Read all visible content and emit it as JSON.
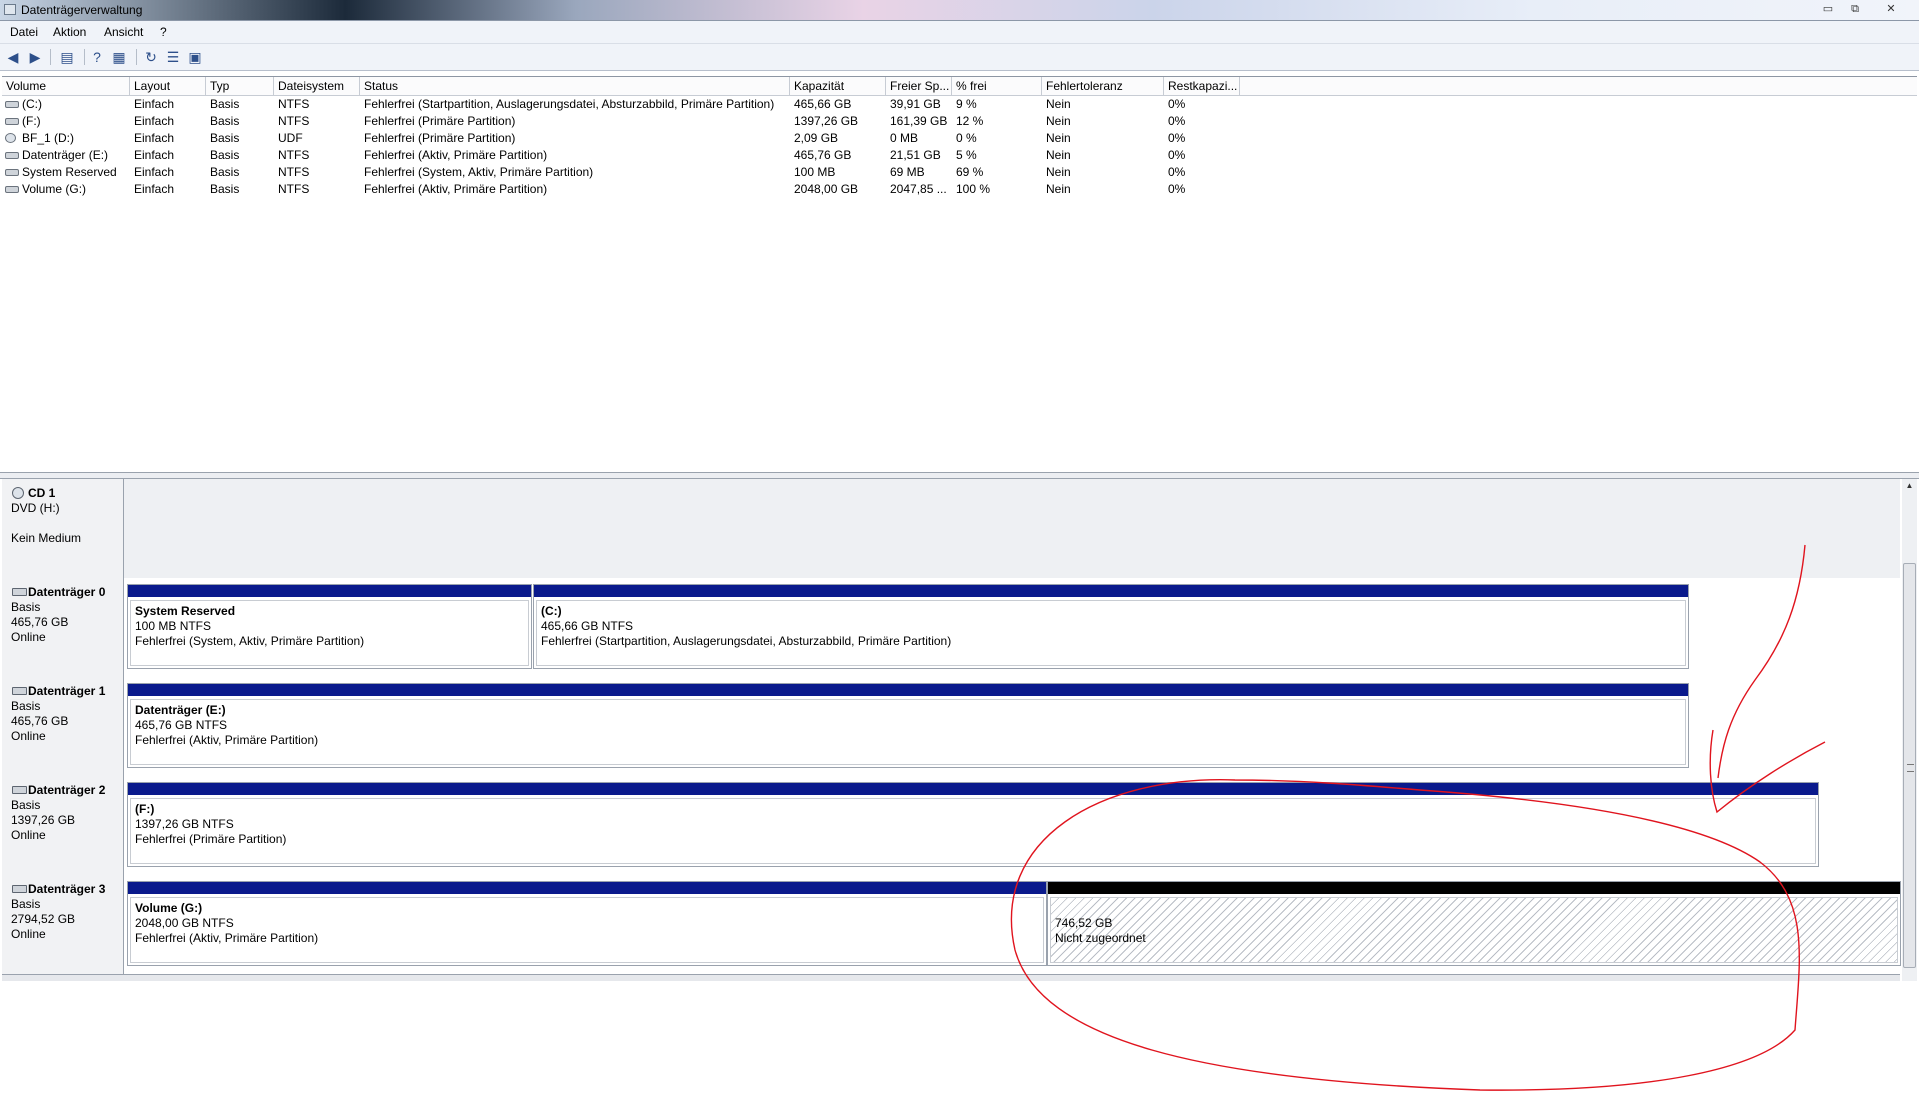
{
  "window": {
    "title": "Datenträgerverwaltung",
    "controls": {
      "minimize": "▭",
      "maximize": "⧉",
      "close": "✕"
    }
  },
  "menu": [
    "Datei",
    "Aktion",
    "Ansicht",
    "?"
  ],
  "toolbar": {
    "buttons": [
      "back-arrow-icon",
      "forward-arrow-icon",
      "console-tree-icon",
      "help-icon",
      "properties-icon",
      "refresh-icon",
      "settings-icon",
      "disk-icon"
    ]
  },
  "volumes": {
    "columns": [
      "Volume",
      "Layout",
      "Typ",
      "Dateisystem",
      "Status",
      "Kapazität",
      "Freier Sp...",
      "% frei",
      "Fehlertoleranz",
      "Restkapazi..."
    ],
    "rows": [
      [
        "(C:)",
        "Einfach",
        "Basis",
        "NTFS",
        "Fehlerfrei (Startpartition, Auslagerungsdatei, Absturzabbild, Primäre Partition)",
        "465,66 GB",
        "39,91 GB",
        "9 %",
        "Nein",
        "0%"
      ],
      [
        "(F:)",
        "Einfach",
        "Basis",
        "NTFS",
        "Fehlerfrei (Primäre Partition)",
        "1397,26 GB",
        "161,39 GB",
        "12 %",
        "Nein",
        "0%"
      ],
      [
        "BF_1 (D:)",
        "Einfach",
        "Basis",
        "UDF",
        "Fehlerfrei (Primäre Partition)",
        "2,09 GB",
        "0 MB",
        "0 %",
        "Nein",
        "0%"
      ],
      [
        "Datenträger (E:)",
        "Einfach",
        "Basis",
        "NTFS",
        "Fehlerfrei (Aktiv, Primäre Partition)",
        "465,76 GB",
        "21,51 GB",
        "5 %",
        "Nein",
        "0%"
      ],
      [
        "System Reserved",
        "Einfach",
        "Basis",
        "NTFS",
        "Fehlerfrei (System, Aktiv, Primäre Partition)",
        "100 MB",
        "69 MB",
        "69 %",
        "Nein",
        "0%"
      ],
      [
        "Volume (G:)",
        "Einfach",
        "Basis",
        "NTFS",
        "Fehlerfrei (Aktiv, Primäre Partition)",
        "2048,00 GB",
        "2047,85 ...",
        "100 %",
        "Nein",
        "0%"
      ]
    ]
  },
  "disks": [
    {
      "name": "CD 1",
      "line1": "DVD (H:)",
      "line2": "",
      "line3": "Kein Medium",
      "partitions": []
    },
    {
      "name": "Datenträger 0",
      "line1": "Basis",
      "line2": "465,76 GB",
      "line3": "Online",
      "partitions": [
        {
          "name": "System Reserved",
          "size": "100 MB NTFS",
          "status": "Fehlerfrei (System, Aktiv, Primäre Partition)"
        },
        {
          "name": "(C:)",
          "size": "465,66 GB NTFS",
          "status": "Fehlerfrei (Startpartition, Auslagerungsdatei, Absturzabbild, Primäre Partition)"
        }
      ]
    },
    {
      "name": "Datenträger 1",
      "line1": "Basis",
      "line2": "465,76 GB",
      "line3": "Online",
      "partitions": [
        {
          "name": "Datenträger  (E:)",
          "size": "465,76 GB NTFS",
          "status": "Fehlerfrei (Aktiv, Primäre Partition)"
        }
      ]
    },
    {
      "name": "Datenträger 2",
      "line1": "Basis",
      "line2": "1397,26 GB",
      "line3": "Online",
      "partitions": [
        {
          "name": "(F:)",
          "size": "1397,26 GB NTFS",
          "status": "Fehlerfrei (Primäre Partition)"
        }
      ]
    },
    {
      "name": "Datenträger 3",
      "line1": "Basis",
      "line2": "2794,52 GB",
      "line3": "Online",
      "partitions": [
        {
          "name": "Volume  (G:)",
          "size": "2048,00 GB NTFS",
          "status": "Fehlerfrei (Aktiv, Primäre Partition)"
        },
        {
          "name": "",
          "size": "746,52 GB",
          "status": "Nicht zugeordnet"
        }
      ]
    }
  ],
  "annotation": {
    "color": "#e0141e"
  }
}
